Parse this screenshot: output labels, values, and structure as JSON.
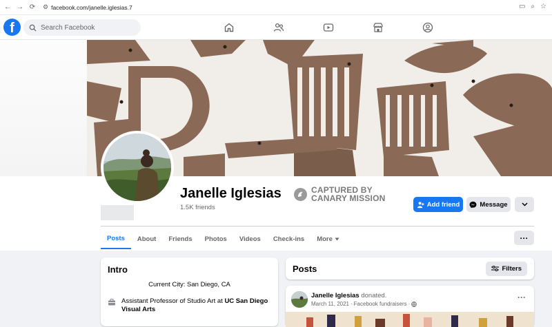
{
  "browser": {
    "url": "facebook.com/janelle.iglesias.7"
  },
  "header": {
    "logo_letter": "f",
    "search_placeholder": "Search Facebook",
    "nav_icons": [
      "home-icon",
      "friends-icon",
      "watch-icon",
      "marketplace-icon",
      "groups-icon"
    ]
  },
  "profile": {
    "name": "Janelle Iglesias",
    "friends": "1.5K friends",
    "badge_line1": "CAPTURED BY",
    "badge_line2": "CANARY MISSION",
    "add_friend_label": "Add friend",
    "message_label": "Message"
  },
  "tabs": [
    {
      "label": "Posts",
      "active": true
    },
    {
      "label": "About"
    },
    {
      "label": "Friends"
    },
    {
      "label": "Photos"
    },
    {
      "label": "Videos"
    },
    {
      "label": "Check-ins"
    },
    {
      "label": "More"
    }
  ],
  "intro": {
    "title": "Intro",
    "city": "Current City: San Diego, CA",
    "job_prefix": "Assistant Professor of Studio Art at ",
    "job_org": "UC San Diego Visual Arts"
  },
  "posts": {
    "title": "Posts",
    "filters_label": "Filters",
    "first": {
      "author": "Janelle Iglesias",
      "action": " donated.",
      "date": "March 11, 2021",
      "source": "Facebook fundraisers"
    }
  },
  "colors": {
    "brand": "#1877f2",
    "background": "#f0f2f5"
  }
}
